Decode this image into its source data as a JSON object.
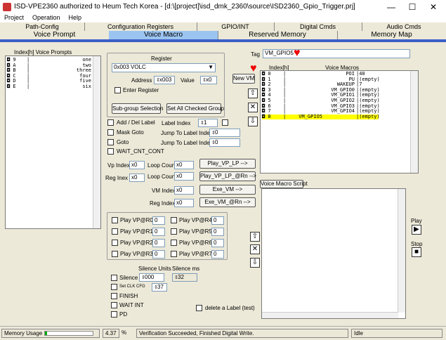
{
  "window": {
    "title": "ISD-VPE2360 authorized to Heum Tech Korea - [d:\u0000[project]\\isd_dmk_2360\\source\\ISD2360_Gpio_Trigger.prj]",
    "minimize": "—",
    "maximize": "☐",
    "close": "✕"
  },
  "menu": [
    "Project",
    "Operation",
    "Help"
  ],
  "tabs_top": [
    "Path-Config",
    "Configuration Registers",
    "GPIO/INT",
    "Digital Cmds",
    "Audio Cmds"
  ],
  "tabs_bottom": [
    "Voice Prompt",
    "Voice Macro",
    "Reserved Memory",
    "Memory Map"
  ],
  "left_panel": {
    "header": "Index[h]  Voice Prompts",
    "rows": [
      {
        "idx": "9",
        "name": "one"
      },
      {
        "idx": "A",
        "name": "two"
      },
      {
        "idx": "B",
        "name": "three"
      },
      {
        "idx": "C",
        "name": "four"
      },
      {
        "idx": "D",
        "name": "five"
      },
      {
        "idx": "E",
        "name": "six"
      }
    ]
  },
  "register": {
    "title": "Register",
    "select": "0x003 VOLC",
    "address_label": "Address",
    "address_value": "x003",
    "value_label": "Value",
    "value_value": "x0",
    "enter_register": "Enter Register"
  },
  "buttons": {
    "subgroup": "Sub-group Selection",
    "set_all": "Set All Checked Group",
    "new_vm": "New VM",
    "play_vp_lp": "Play_VP_LP  -->",
    "play_vp_rn": "Play_VP_LP_@Rn  -->",
    "exe_vm": "Exe_VM  -->",
    "exe_vm_rn": "Exe_VM_@Rn  -->",
    "vm_script": "Voice Macro Script",
    "play_label": "Play",
    "stop_label": "Stop"
  },
  "options": {
    "add_del_label": "Add / Del Label",
    "label_index": "Label Index",
    "label_index_value": "1",
    "mask_goto": "Mask Goto",
    "jump_mask": "Jump To Label Index",
    "jump_mask_value": "0",
    "goto": "Goto",
    "jump_goto": "Jump To Label Index",
    "jump_goto_value": "0",
    "wait_cnt": "WAIT_CNT_CONT"
  },
  "loops": {
    "vp_index": "Vp Index",
    "vp_index_value": "x0",
    "loop_count": "Loop Count",
    "loop_count_value": "x0",
    "reg_inex": "Reg Inex",
    "reg_inex_value": "x0",
    "loop_count2": "Loop Count",
    "loop_count2_value": "x0",
    "vm_index": "VM Index",
    "vm_index_value": "x0",
    "reg_index": "Reg Index",
    "reg_index_value": "x0"
  },
  "play_vp": [
    {
      "label": "Play VP@R0",
      "value": "0"
    },
    {
      "label": "Play VP@R4",
      "value": "0"
    },
    {
      "label": "Play VP@R1",
      "value": "0"
    },
    {
      "label": "Play VP@R5",
      "value": "0"
    },
    {
      "label": "Play VP@R2",
      "value": "0"
    },
    {
      "label": "Play VP@R6",
      "value": "0"
    },
    {
      "label": "Play VP@R3",
      "value": "0"
    },
    {
      "label": "Play VP@R7",
      "value": "0"
    }
  ],
  "silence": {
    "units_label": "Silence Units",
    "ms_label": "Silence ms",
    "silence": "Silence",
    "silence_value": "000",
    "ms_value": "32",
    "set_clk": "Set CLK CFG",
    "set_clk_value": "37",
    "finish": "FINISH",
    "wait_int": "WAIT INT",
    "pd": "PD",
    "delete_label": "delete a Label (test)"
  },
  "tag": {
    "label": "Tag",
    "value": "VM_GPIO5"
  },
  "macros": {
    "header_idx": "Index[h]",
    "header_name": "Voice Macros",
    "rows": [
      {
        "idx": "0",
        "name": "POI",
        "val": "40"
      },
      {
        "idx": "1",
        "name": "PU",
        "val": "(empty)"
      },
      {
        "idx": "2",
        "name": "WAKEUP",
        "val": "7"
      },
      {
        "idx": "3",
        "name": "VM_GPIO0",
        "val": "(empty)"
      },
      {
        "idx": "4",
        "name": "VM_GPIO1",
        "val": "(empty)"
      },
      {
        "idx": "5",
        "name": "VM_GPIO2",
        "val": "(empty)"
      },
      {
        "idx": "6",
        "name": "VM_GPIO3",
        "val": "(empty)"
      },
      {
        "idx": "7",
        "name": "VM_GPIO4",
        "val": "(empty)"
      },
      {
        "idx": "8",
        "name": "VM_GPIO5",
        "val": "(empty)"
      }
    ]
  },
  "status": {
    "memory_label": "Memory Usage",
    "memory_pct": "4.37",
    "pct_sign": "%",
    "message": "Verification Succeeded, Finished Digital Write.",
    "state": "Idle",
    "memory_fill": 0.045
  }
}
